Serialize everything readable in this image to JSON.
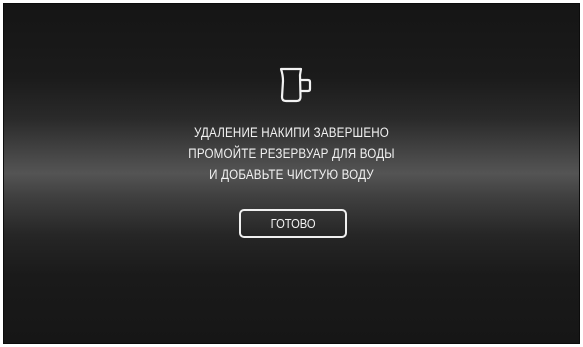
{
  "screen": {
    "icon": "water-jug-icon",
    "message_lines": [
      "УДАЛЕНИЕ НАКИПИ ЗАВЕРШЕНО",
      "ПРОМОЙТЕ РЕЗЕРВУАР ДЛЯ ВОДЫ",
      "И ДОБАВЬТЕ ЧИСТУЮ ВОДУ"
    ],
    "done_label": "ГОТОВО"
  },
  "colors": {
    "background": "#1b1b1b",
    "text": "#f2f2f2",
    "button_border": "#f0f0f0"
  }
}
